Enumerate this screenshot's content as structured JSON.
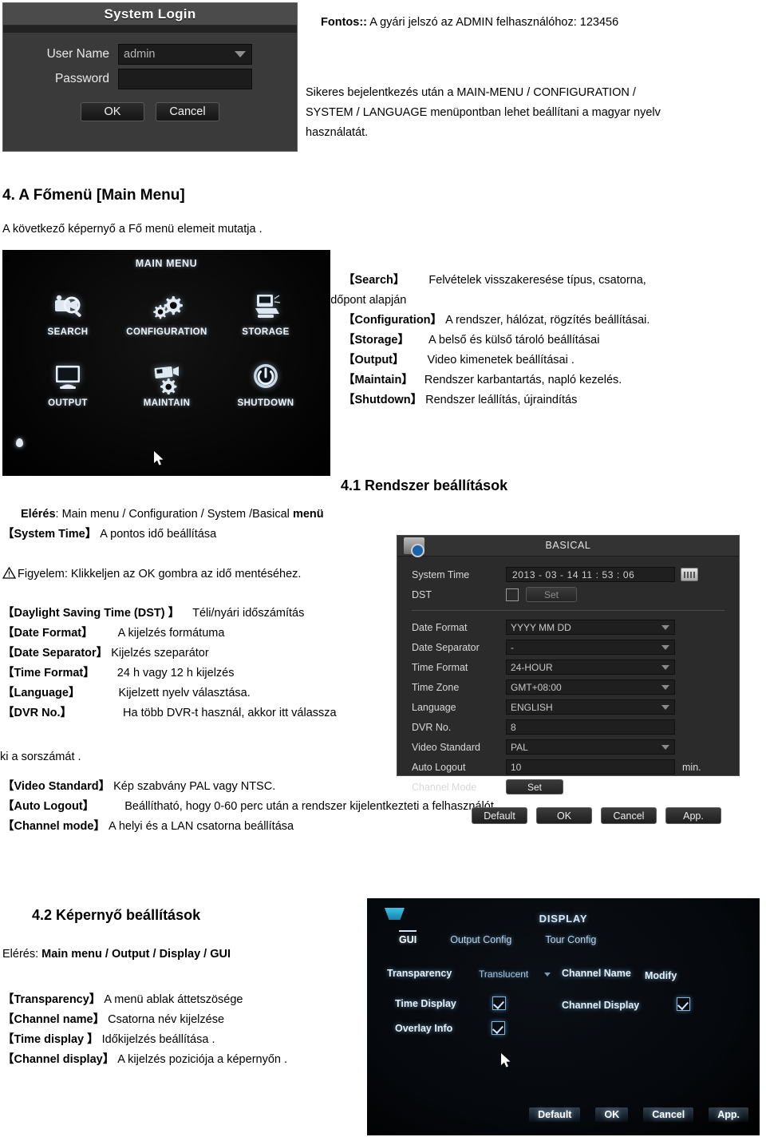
{
  "login_dialog": {
    "title": "System Login",
    "username_label": "User Name",
    "username_value": "admin",
    "password_label": "Password",
    "password_value": "",
    "ok_label": "OK",
    "cancel_label": "Cancel"
  },
  "important_note": {
    "bold_prefix": "Fontos::",
    "rest": " A gyári jelszó az ADMIN felhasználóhoz: 123456"
  },
  "intro_paragraph": {
    "line1": "Sikeres bejelentkezés után a MAIN-MENU / CONFIGURATION /",
    "line2": "SYSTEM / LANGUAGE menüpontban lehet beállítani a magyar nyelv",
    "line3": "használatát."
  },
  "section4": {
    "heading": "4.   A Főmenü    [Main Menu]",
    "subtitle": "A következő képernyő a Fő menü elemeit mutatja ."
  },
  "main_menu_screen": {
    "title": "MAIN MENU",
    "items": [
      {
        "label": "SEARCH",
        "icon": "search-camera-icon"
      },
      {
        "label": "CONFIGURATION",
        "icon": "gears-icon"
      },
      {
        "label": "STORAGE",
        "icon": "hard-disk-icon"
      },
      {
        "label": "OUTPUT",
        "icon": "monitor-icon"
      },
      {
        "label": "MAINTAIN",
        "icon": "camera-gear-icon"
      },
      {
        "label": "SHUTDOWN",
        "icon": "power-icon"
      }
    ]
  },
  "menu_descriptions": [
    {
      "term": "【Search】",
      "desc": "Felvételek visszakeresése   típus, csatorna,"
    },
    {
      "term": "",
      "desc": "időpont   alapján"
    },
    {
      "term": "【Configuration】",
      "desc": "A   rendszer, hálózat, rögzítés beállításai."
    },
    {
      "term": "【Storage】",
      "desc": "A belső és külső   tároló beállításai"
    },
    {
      "term": "【Output】",
      "desc": "Video kimenetek   beállításai ."
    },
    {
      "term": "【Maintain】",
      "desc": "Rendszer karbantartás,   napló kezelés."
    },
    {
      "term": "【Shutdown】",
      "desc": "Rendszer leállítás, újraindítás"
    }
  ],
  "section41": {
    "heading": "4.1 Rendszer beállítások",
    "path_label": "Elérés",
    "path_rest": ": Main menu / Configuration / System /Basical ",
    "path_bold_tail": "menü",
    "system_time_term": "【System Time】",
    "system_time_desc": " A pontos idő beállítása",
    "warning": "Figyelem: Klikkeljen az OK gombra az idő mentéséhez."
  },
  "basic_items": [
    {
      "term": "【Daylight Saving Time (DST) 】",
      "desc": "Téli/nyári időszámítás"
    },
    {
      "term": "【Date Format】",
      "desc": "A kijelzés formátuma"
    },
    {
      "term": "【Date Separator】",
      "desc": "Kijelzés szeparátor"
    },
    {
      "term": "【Time Format】",
      "desc": "24 h vagy 12 h kijelzés"
    },
    {
      "term": "【Language】",
      "desc": "Kijelzett nyelv választása."
    },
    {
      "term": "【DVR No.】",
      "desc": "Ha több DVR-t használ, akkor itt válassza"
    }
  ],
  "basic_items_continued": "ki a sorszámát .",
  "basic_items_2": [
    {
      "term": "【Video Standard】",
      "desc": "Kép szabvány PAL vagy NTSC."
    },
    {
      "term": "【Auto Logout】",
      "desc": "Beállítható, hogy 0-60 perc után a rendszer kijelentkezteti a felhasználót"
    },
    {
      "term": "【Channel mode】",
      "desc": "A helyi és a LAN csatorna beállítása"
    }
  ],
  "basical_dialog": {
    "title": "BASICAL",
    "rows": [
      {
        "label": "System Time",
        "value": "2013  -  03  -  14    11 : 53 : 06",
        "type": "time"
      },
      {
        "label": "DST",
        "value": "Set",
        "type": "checkbox-set"
      },
      {
        "label": "Date Format",
        "value": "YYYY MM DD",
        "type": "select"
      },
      {
        "label": "Date Separator",
        "value": "-",
        "type": "select"
      },
      {
        "label": "Time Format",
        "value": "24-HOUR",
        "type": "select"
      },
      {
        "label": "Time Zone",
        "value": "GMT+08:00",
        "type": "select"
      },
      {
        "label": "Language",
        "value": "ENGLISH",
        "type": "select"
      },
      {
        "label": "DVR No.",
        "value": "8",
        "type": "text"
      },
      {
        "label": "Video Standard",
        "value": "PAL",
        "type": "select"
      },
      {
        "label": "Auto Logout",
        "value": "10",
        "type": "text",
        "suffix": "min."
      },
      {
        "label": "Channel Mode",
        "value": "Set",
        "type": "button"
      }
    ],
    "buttons": [
      "Default",
      "OK",
      "Cancel",
      "App."
    ]
  },
  "section42": {
    "heading": "4.2 Képernyő beállítások",
    "path_label": "Elérés: ",
    "path_value": "Main menu / Output / Display / GUI"
  },
  "display_items": [
    {
      "term": "【Transparency】",
      "desc": "A menü ablak áttetszösége"
    },
    {
      "term": "【Channel name】",
      "desc": "Csatorna név kijelzése"
    },
    {
      "term": "【Time display 】",
      "desc": "Időkijelzés beállítása ."
    },
    {
      "term": "【Channel display】",
      "desc": "A kijelzés poziciója a képernyőn ."
    }
  ],
  "display_dialog": {
    "title": "DISPLAY",
    "tabs": [
      "GUI",
      "Output Config",
      "Tour Config"
    ],
    "transparency_label": "Transparency",
    "transparency_value": "Translucent",
    "channel_name_label": "Channel Name",
    "channel_name_value": "Modify",
    "time_display_label": "Time Display",
    "channel_display_label": "Channel Display",
    "overlay_info_label": "Overlay Info",
    "buttons": [
      "Default",
      "OK",
      "Cancel",
      "App."
    ]
  },
  "colors": {
    "dialog_bg": "#2b2b2b",
    "accent_blue": "#37c6e8",
    "text_light": "#e4e4e4"
  }
}
